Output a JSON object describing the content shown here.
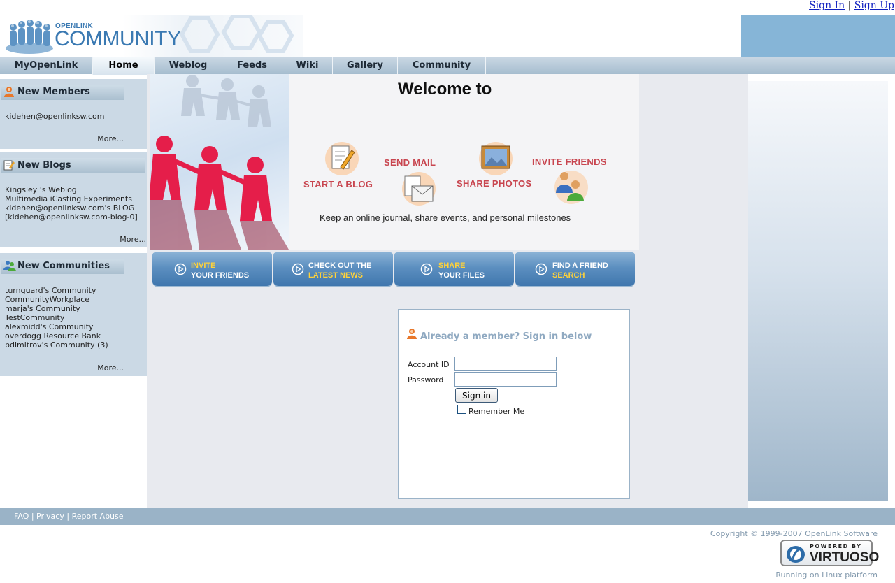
{
  "auth": {
    "sign_in": "Sign In",
    "separator": "|",
    "sign_up": "Sign Up"
  },
  "header": {
    "logo_small": "OPENLINK",
    "logo_big": "COMMUNITY"
  },
  "nav": {
    "tabs": [
      {
        "label": "MyOpenLink",
        "active": false
      },
      {
        "label": "Home",
        "active": true
      },
      {
        "label": "Weblog",
        "active": false
      },
      {
        "label": "Feeds",
        "active": false
      },
      {
        "label": "Wiki",
        "active": false
      },
      {
        "label": "Gallery",
        "active": false
      },
      {
        "label": "Community",
        "active": false
      }
    ]
  },
  "sidebar": {
    "members": {
      "title": "New Members",
      "items": [
        "kidehen@openlinksw.com"
      ],
      "more": "More..."
    },
    "blogs": {
      "title": "New Blogs",
      "items": [
        "Kingsley 's Weblog",
        "Multimedia iCasting Experiments",
        "kidehen@openlinksw.com's BLOG",
        "[kidehen@openlinksw.com-blog-0]"
      ],
      "more": "More..."
    },
    "communities": {
      "title": "New Communities",
      "items": [
        "turnguard's Community",
        "CommunityWorkplace",
        "marja's Community",
        "TestCommunity",
        "alexmidd's Community",
        "overdogg Resource Bank",
        "bdimitrov's Community (3)"
      ],
      "more": "More..."
    }
  },
  "banner": {
    "welcome": "Welcome to",
    "features": {
      "start_blog": "START A BLOG",
      "send_mail": "SEND MAIL",
      "share_photos": "SHARE PHOTOS",
      "invite_friends": "INVITE FRIENDS"
    },
    "tagline": "Keep an online journal, share events,  and personal milestones"
  },
  "actions": [
    {
      "line1": "INVITE",
      "line2": "YOUR FRIENDS"
    },
    {
      "line1": "CHECK OUT THE",
      "line2": "LATEST NEWS"
    },
    {
      "line1": "SHARE",
      "line2": "YOUR FILES"
    },
    {
      "line1": "FIND A FRIEND",
      "line2": "SEARCH"
    }
  ],
  "login": {
    "title": "Already a member? Sign in below",
    "account_label": "Account ID",
    "account_value": "",
    "password_label": "Password",
    "password_value": "",
    "button": "Sign in",
    "remember": "Remember Me",
    "remember_checked": false
  },
  "footer": {
    "links": [
      "FAQ",
      "Privacy",
      "Report Abuse"
    ],
    "separator": "|",
    "copyright": "Copyright © 1999-2007 OpenLink Software",
    "badge_top": "POWERED BY",
    "badge_main": "VIRTUOSO",
    "running": "Running on Linux platform"
  },
  "colors": {
    "nav_bg": "#a6bdcf",
    "sidebar_bg": "#cbd9e5",
    "feature_red": "#c8454f",
    "action_blue": "#4f84b8",
    "action_yellow": "#ffd23a",
    "footer_bg": "#9ab3c7",
    "link_blue": "#1020c0"
  }
}
